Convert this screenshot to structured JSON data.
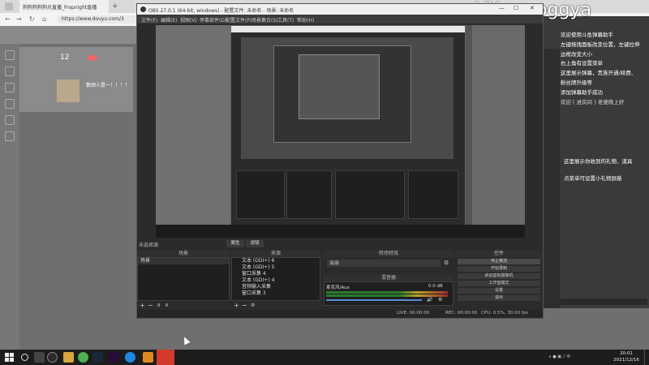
{
  "browser": {
    "tabs": [
      "狗狗狗狗狗光直播_Fropnight直播",
      "",
      ""
    ],
    "url": "https://www.douyu.com/3"
  },
  "stream_card": {
    "follower_count": "12",
    "streamer_name": "鹅颈人是一！！！！"
  },
  "brand": "VX+yaoggya",
  "overlay": {
    "lines": [
      "欢迎使用斗鱼弹幕助手",
      "左键拖拽面板改变位置，左键拉伸",
      "边框改变大小",
      "右上角有设置菜单",
      "这里展示弹幕，贵族开通/续费、",
      "粉丝牌升级等",
      "添加弹幕助手成功"
    ],
    "welcome": "欢迎 [ 进房间 ]  老婆晚上好",
    "gift_note": "这里展示你收到的礼物、道具",
    "small_gift_note": "点菜单可设置小礼物屏蔽"
  },
  "obs": {
    "title": "OBS 27.0.1 (64-bit, windows) - 配置文件: 未命名 - 场景: 未命名",
    "menu": [
      "文件(F)",
      "编辑(E)",
      "视图(V)",
      "停靠部件(D)",
      "配置文件(P)",
      "场景集合(S)",
      "工具(T)",
      "帮助(H)"
    ],
    "no_source": "未选择源",
    "properties": "属性",
    "filters": "滤镜",
    "docks": {
      "scenes": "场景",
      "sources": "来源",
      "transitions": "转场特效",
      "mixer": "混音器",
      "controls": "控件"
    },
    "scene": "场景",
    "sources": [
      "文本 (GDI+) 6",
      "文本 (GDI+) 5",
      "窗口采集 4",
      "文本 (GDI+) 4",
      "音频输入采集",
      "窗口采集 3"
    ],
    "transition": "淡出",
    "mixer_track": "麦克风/Aux",
    "mixer_db": "0.0 dB",
    "controls": [
      "停止推流",
      "开始录制",
      "启动虚拟摄像机",
      "工作室模式",
      "设置",
      "退出"
    ],
    "status": {
      "live": "LIVE: 00:00:00",
      "rec": "REC: 00:00:00",
      "cpu": "CPU: 0.5%, 30.00 fps"
    }
  },
  "clock": {
    "time": "20:01",
    "date": "2021/12/16"
  }
}
